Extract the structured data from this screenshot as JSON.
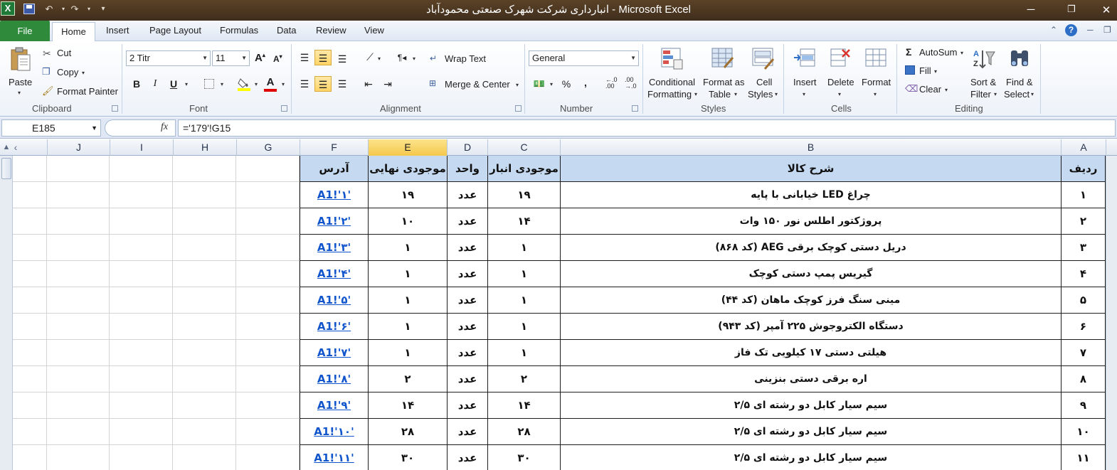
{
  "window": {
    "title": "انبارداری شرکت شهرک صنعتی محمودآباد  -  Microsoft Excel",
    "app_icon": "X"
  },
  "ribbon_tabs": [
    "File",
    "Home",
    "Insert",
    "Page Layout",
    "Formulas",
    "Data",
    "Review",
    "View"
  ],
  "ribbon": {
    "clipboard": {
      "paste": "Paste",
      "cut": "Cut",
      "copy": "Copy",
      "format_painter": "Format Painter",
      "label": "Clipboard"
    },
    "font": {
      "name": "2  Titr",
      "size": "11",
      "label": "Font",
      "bold": "B",
      "italic": "I",
      "underline": "U",
      "grow": "A",
      "shrink": "A",
      "font_color": "A"
    },
    "alignment": {
      "wrap": "Wrap Text",
      "merge": "Merge & Center",
      "label": "Alignment"
    },
    "number": {
      "format": "General",
      "percent": "%",
      "comma": ",",
      "inc_decimal": ".0  .00",
      "dec_decimal": ".00  .0",
      "label": "Number",
      "inc_decimal_a": "←.0",
      "inc_decimal_b": ".00",
      "dec_decimal_a": ".00",
      "dec_decimal_b": "→.0"
    },
    "styles": {
      "conditional": "Conditional",
      "conditional2": "Formatting",
      "format_as": "Format as",
      "format_as2": "Table",
      "cell": "Cell",
      "cell2": "Styles",
      "label": "Styles"
    },
    "cells": {
      "insert": "Insert",
      "delete": "Delete",
      "format": "Format",
      "label": "Cells"
    },
    "editing": {
      "autosum": "AutoSum",
      "fill": "Fill",
      "clear": "Clear",
      "sort": "Sort &",
      "sort2": "Filter",
      "find": "Find &",
      "find2": "Select",
      "label": "Editing",
      "sigma": "Σ"
    }
  },
  "formula_bar": {
    "name_box": "E185",
    "fx": "fx",
    "formula": "='179'!G15"
  },
  "columns": [
    "J",
    "I",
    "H",
    "G",
    "F",
    "E",
    "D",
    "C",
    "B",
    "A"
  ],
  "selected_column": "E",
  "table": {
    "headers": {
      "address": "آدرس",
      "final_stock": "موجودی نهایی",
      "unit": "واحد",
      "warehouse_stock": "موجودی انبار",
      "description": "شرح کالا",
      "row_no": "ردیف"
    },
    "rows": [
      {
        "address": "A1!'۱'",
        "final": "۱۹",
        "unit": "عدد",
        "stock": "۱۹",
        "desc": "چراغ LED خیابانی با پایه",
        "no": "۱"
      },
      {
        "address": "A1!'۲'",
        "final": "۱۰",
        "unit": "عدد",
        "stock": "۱۴",
        "desc": "پروژکتور اطلس نور ۱۵۰ وات",
        "no": "۲"
      },
      {
        "address": "A1!'۳'",
        "final": "۱",
        "unit": "عدد",
        "stock": "۱",
        "desc": "دریل دستی کوچک برقی AEG (کد ۸۶۸)",
        "no": "۳"
      },
      {
        "address": "A1!'۴'",
        "final": "۱",
        "unit": "عدد",
        "stock": "۱",
        "desc": "گیریس پمپ دستی کوچک",
        "no": "۴"
      },
      {
        "address": "A1!'۵'",
        "final": "۱",
        "unit": "عدد",
        "stock": "۱",
        "desc": "مینی سنگ فرز کوچک ماهان (کد ۴۴)",
        "no": "۵"
      },
      {
        "address": "A1!'۶'",
        "final": "۱",
        "unit": "عدد",
        "stock": "۱",
        "desc": "دستگاه الکتروجوش ۲۲۵ آمپر (کد ۹۴۳)",
        "no": "۶"
      },
      {
        "address": "A1!'۷'",
        "final": "۱",
        "unit": "عدد",
        "stock": "۱",
        "desc": "هیلتی دستی ۱۷ کیلویی تک فاز",
        "no": "۷"
      },
      {
        "address": "A1!'۸'",
        "final": "۲",
        "unit": "عدد",
        "stock": "۲",
        "desc": "اره برقی دستی بنزینی",
        "no": "۸"
      },
      {
        "address": "A1!'۹'",
        "final": "۱۴",
        "unit": "عدد",
        "stock": "۱۴",
        "desc": "سیم سیار کابل دو رشته ای ۲/۵",
        "no": "۹"
      },
      {
        "address": "A1!'۱۰'",
        "final": "۲۸",
        "unit": "عدد",
        "stock": "۲۸",
        "desc": "سیم سیار کابل دو رشته ای ۲/۵",
        "no": "۱۰"
      },
      {
        "address": "A1!'۱۱'",
        "final": "۳۰",
        "unit": "عدد",
        "stock": "۳۰",
        "desc": "سیم سیار کابل دو رشته ای ۲/۵",
        "no": "۱۱"
      }
    ]
  },
  "colors": {
    "file_tab": "#2f8a3c",
    "header_fill": "#c5d9f1",
    "link": "#1155cc",
    "selected_col": "#f5c84c"
  }
}
